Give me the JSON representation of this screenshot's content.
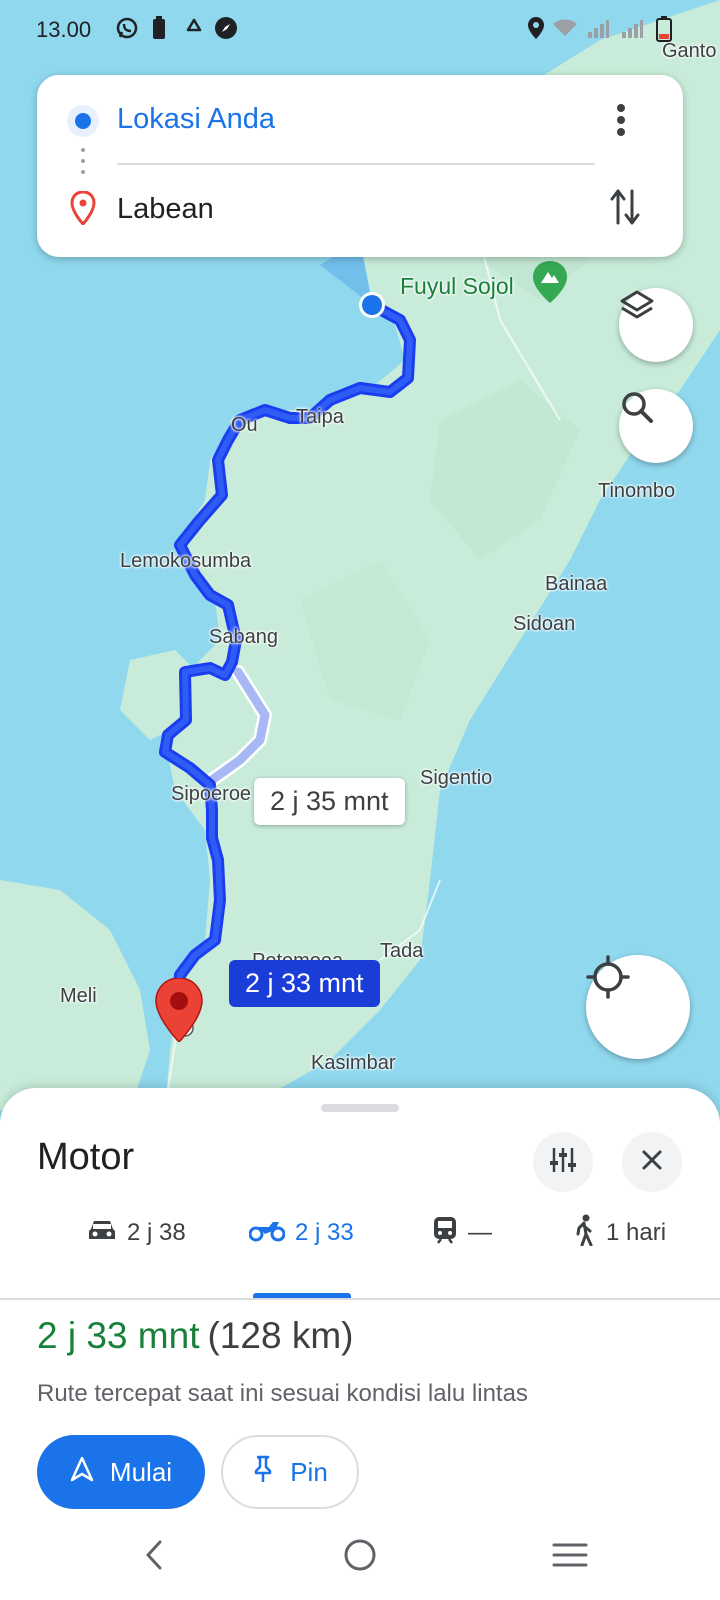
{
  "status_bar": {
    "time": "13.00"
  },
  "search": {
    "origin": "Lokasi Anda",
    "destination": "Labean"
  },
  "map": {
    "places": {
      "ganto": "Ganto",
      "fuyul_sojol": "Fuyul Sojol",
      "taipa": "Taipa",
      "ou": "Ou",
      "tinombo": "Tinombo",
      "lemokosumba": "Lemokosumba",
      "bainaa": "Bainaa",
      "sidoan": "Sidoan",
      "sabang": "Sabang",
      "sigentio": "Sigentio",
      "sipoeroe": "Sipoeroe",
      "tada": "Tada",
      "potomoea": "Potomoea",
      "meli": "Meli",
      "kasimbar": "Kasimbar"
    },
    "alt_route_label": "2 j 35 mnt",
    "main_route_label": "2 j 33 mnt"
  },
  "sheet": {
    "title": "Motor",
    "modes": [
      {
        "icon": "car-icon",
        "label": "2 j 38"
      },
      {
        "icon": "motorcycle-icon",
        "label": "2 j 33"
      },
      {
        "icon": "train-icon",
        "label": "—"
      },
      {
        "icon": "walk-icon",
        "label": "1 hari"
      }
    ],
    "summary": {
      "duration": "2 j 33 mnt",
      "distance": "(128 km)",
      "description": "Rute tercepat saat ini sesuai kondisi lalu lintas"
    },
    "start_label": "Mulai",
    "pin_label": "Pin"
  },
  "colors": {
    "accent": "#1a73e8",
    "duration_green": "#188038",
    "route_blue": "#1a3df0",
    "water": "#8fd8ee",
    "land": "#c8ecd9",
    "pin_red": "#ea4335"
  }
}
